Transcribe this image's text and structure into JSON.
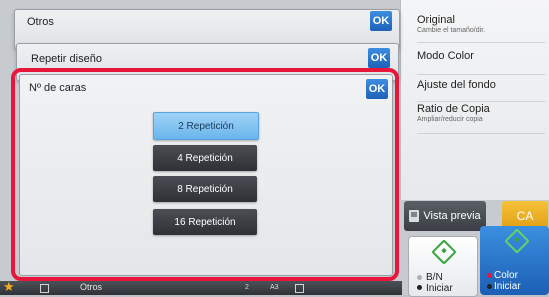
{
  "right_panel": {
    "items": [
      {
        "title": "Original",
        "subtitle": "Cambie el tamaño/dir."
      },
      {
        "title": "Modo Color",
        "subtitle": ""
      },
      {
        "title": "Ajuste del fondo",
        "subtitle": ""
      },
      {
        "title": "Ratio de Copia",
        "subtitle": "Ampliar/reducir copia"
      }
    ]
  },
  "preview_label": "Vista previa",
  "ca_label": "CA",
  "start_bw": {
    "line1": "B/N",
    "line2": "Iniciar"
  },
  "start_color": {
    "line1": "Color",
    "line2": "Iniciar"
  },
  "dialogs": {
    "otros": {
      "title": "Otros",
      "ok": "OK"
    },
    "repetir": {
      "title": "Repetir diseño",
      "ok": "OK"
    },
    "caras": {
      "title": "Nº de caras",
      "ok": "OK"
    }
  },
  "options": [
    {
      "label": "2 Repetición",
      "selected": true
    },
    {
      "label": "4 Repetición",
      "selected": false
    },
    {
      "label": "8 Repetición",
      "selected": false
    },
    {
      "label": "16 Repetición",
      "selected": false
    }
  ],
  "bottom_bar": {
    "label": "Otros",
    "page": "2",
    "paper": "A3"
  },
  "colors": {
    "highlight": "#e8163a",
    "ok": "#1d62b8",
    "selected": "#6ab6ec",
    "ca": "#e19d12"
  }
}
